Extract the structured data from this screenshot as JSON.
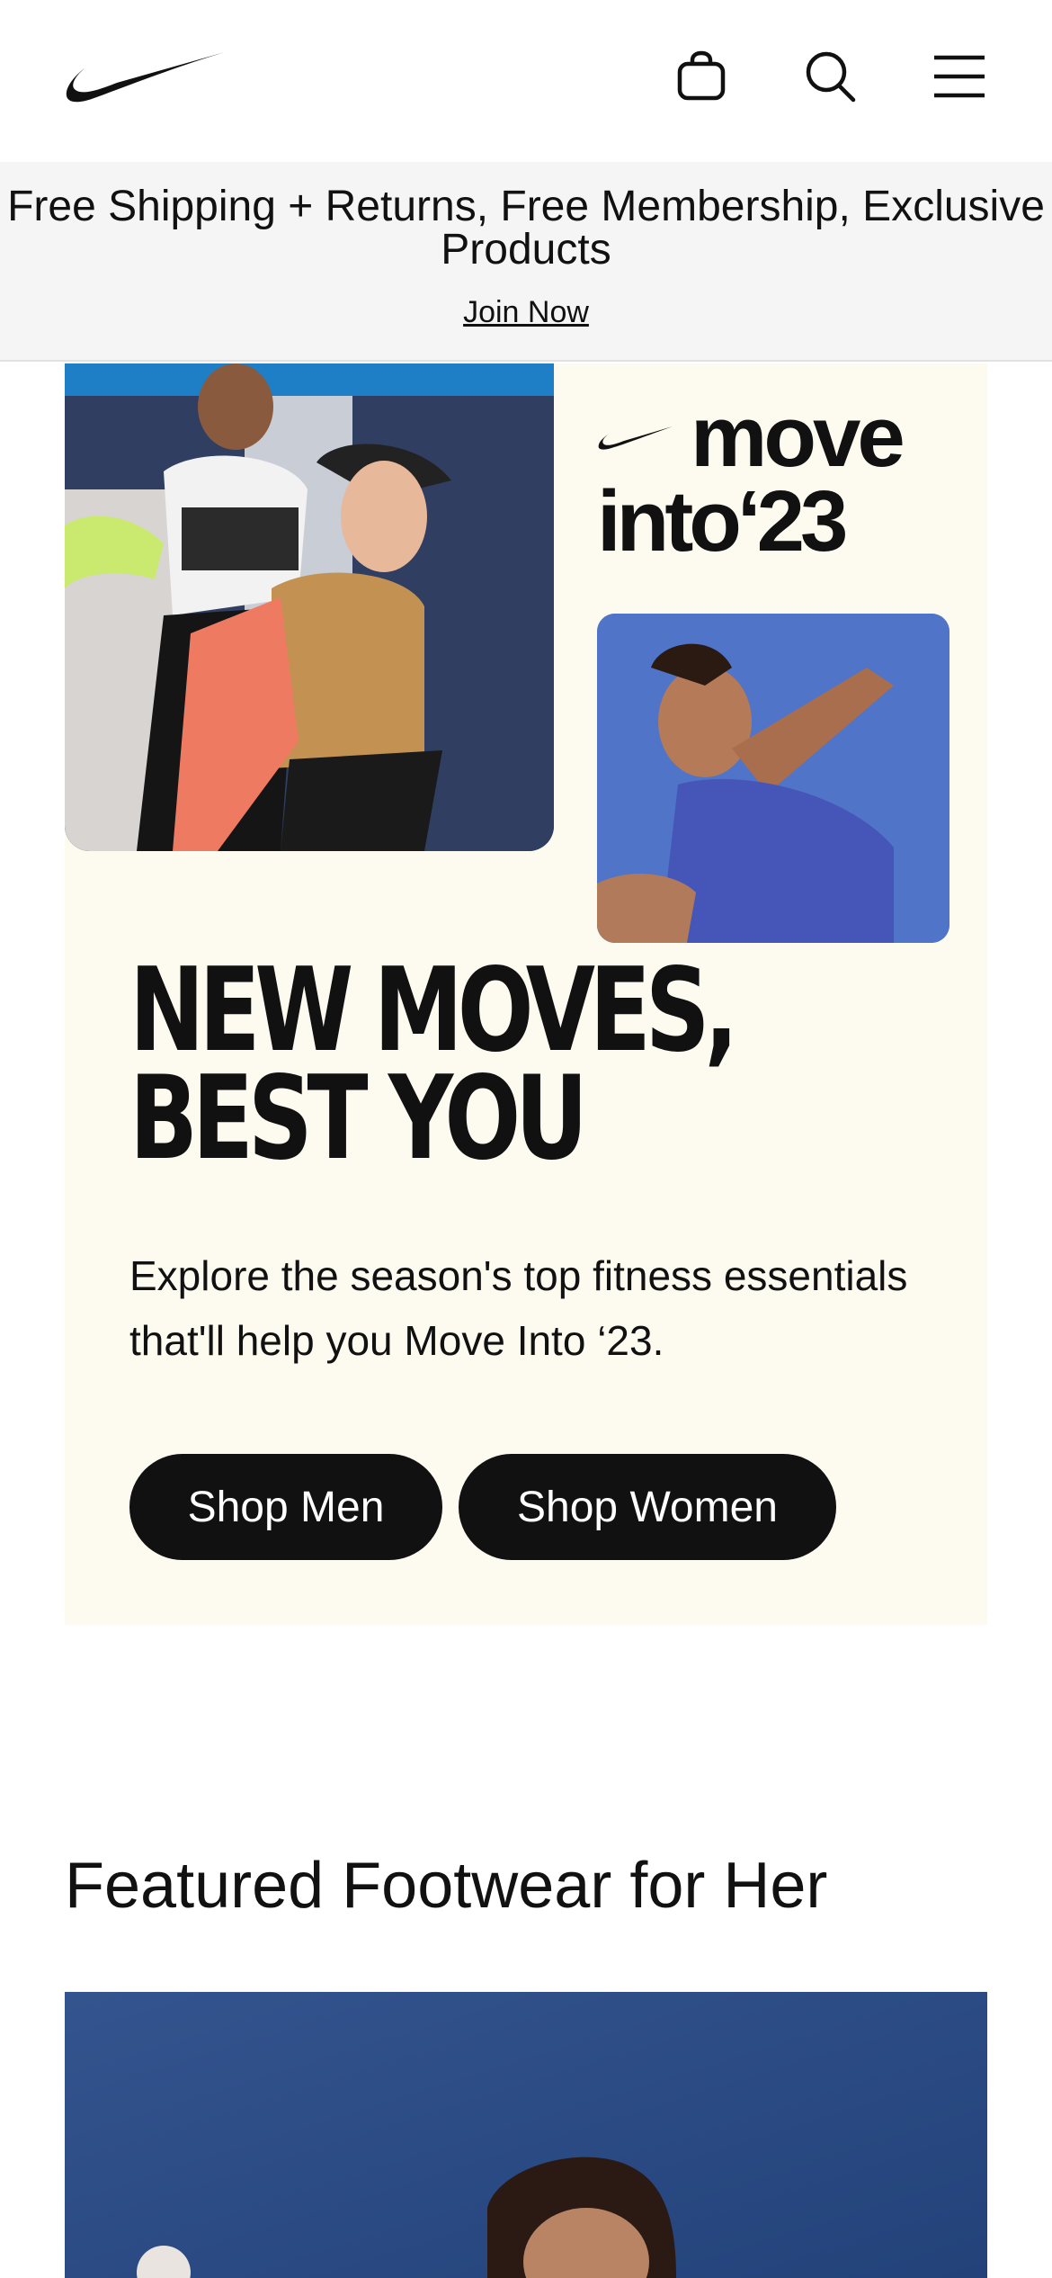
{
  "header": {
    "logo_name": "nike-swoosh-logo",
    "icons": [
      "shopping-bag-icon",
      "search-icon",
      "hamburger-menu-icon"
    ]
  },
  "promo": {
    "text": "Free Shipping + Returns, Free Membership, Exclusive Products",
    "link": "Join Now"
  },
  "hero": {
    "brand_line1": "move",
    "brand_line2": "into‘23",
    "headline_line1": "NEW MOVES,",
    "headline_line2": "BEST YOU",
    "description": "Explore the season's top fitness essentials that'll help you Move Into ‘23.",
    "buttons": {
      "shop_men": "Shop Men",
      "shop_women": "Shop Women"
    },
    "background_color": "#fdfbf0"
  },
  "featured": {
    "title": "Featured Footwear for Her"
  },
  "colors": {
    "primary": "#111111",
    "promo_bg": "#f5f5f5",
    "button_text": "#ffffff"
  }
}
